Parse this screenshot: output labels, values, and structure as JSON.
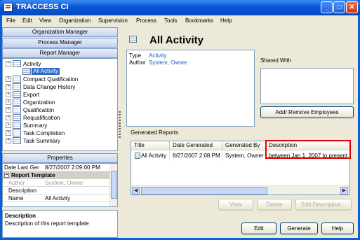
{
  "window": {
    "title": "TRACCESS CI",
    "min": "_",
    "max": "□",
    "close": "✕"
  },
  "menu": [
    "File",
    "Edit",
    "View",
    "Organization",
    "Supervision",
    "Process",
    "Tools",
    "Bookmarks",
    "Help"
  ],
  "managers": {
    "organization": "Organization Manager",
    "process": "Process Manager",
    "report": "Report Manager"
  },
  "tree": {
    "root": "Activity",
    "selected": "All Activity",
    "items": [
      "Compact Qualification",
      "Data Change History",
      "Export",
      "Organization",
      "Qualification",
      "Requalification",
      "Summary",
      "Task Completion",
      "Task Summary"
    ],
    "expand_glyph": "+",
    "collapse_glyph": "−"
  },
  "properties": {
    "header": "Properties",
    "date_last_gen_label": "Date Last Ger",
    "date_last_gen_value": "8/27/2007 2:09:00 PM",
    "category": "Report Template",
    "author_label": "Author",
    "author_value": "System, Owner",
    "description_label": "Description",
    "description_value": "",
    "name_label": "Name",
    "name_value": "All Activity"
  },
  "description_panel": {
    "title": "Description",
    "text": "Description of this report template"
  },
  "main": {
    "title": "All Activity",
    "type_label": "Type",
    "type_value": "Activity",
    "author_label": "Author",
    "author_value": "System, Owner",
    "shared_with_label": "Shared With",
    "add_remove_button": "Add/ Remove Employees",
    "generated_reports_label": "Generated Reports",
    "columns": [
      "Title",
      "Date Generated",
      "Generated By",
      "Description"
    ],
    "rows": [
      {
        "title": "All Activity",
        "date": "8/27/2007 2:08 PM",
        "by": "System, Owner",
        "description": "between Jan 1, 2007 to present"
      }
    ],
    "view_button": "View",
    "delete_button": "Delete",
    "edit_desc_button": "Edit Description...",
    "edit_button": "Edit",
    "generate_button": "Generate",
    "help_button": "Help"
  },
  "scroll": {
    "left": "◀",
    "right": "▶"
  }
}
